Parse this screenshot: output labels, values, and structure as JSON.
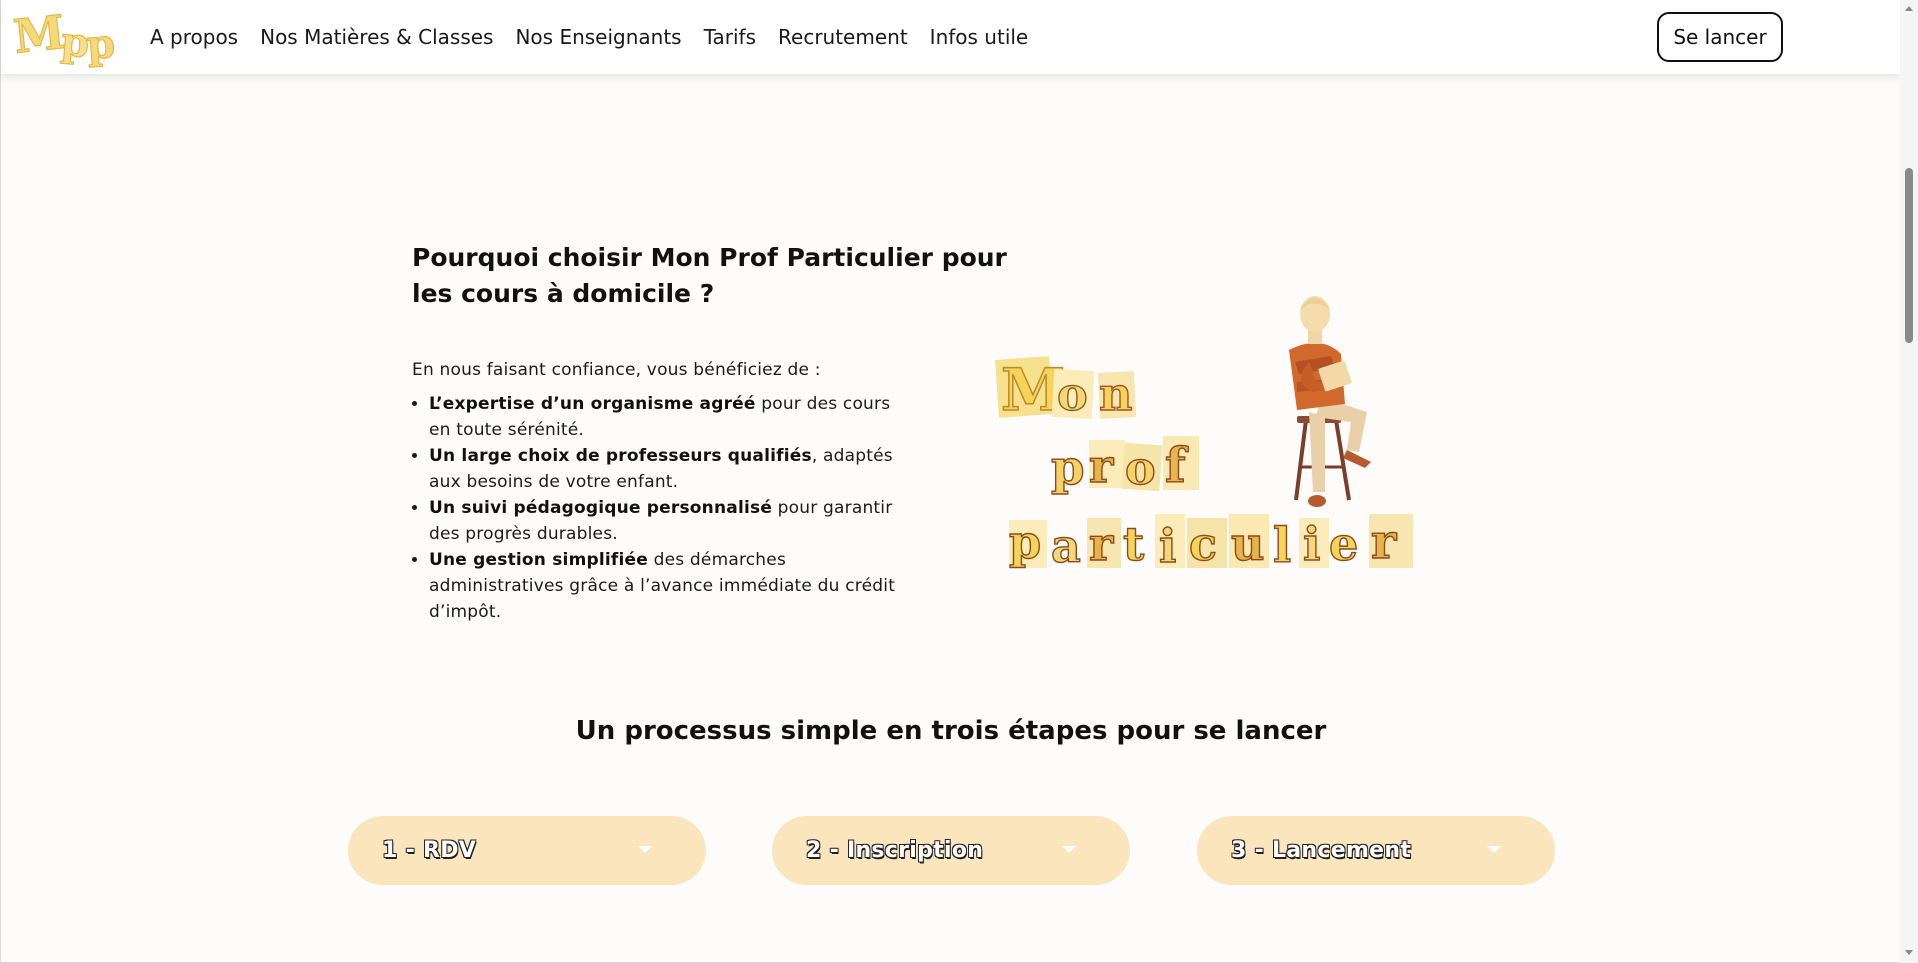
{
  "brand": {
    "logo_text": "Mpp",
    "accent_color": "#f6d978",
    "step_color": "#fbe5bd"
  },
  "nav": {
    "items": [
      {
        "label": "A propos"
      },
      {
        "label": "Nos Matières & Classes"
      },
      {
        "label": "Nos Enseignants"
      },
      {
        "label": "Tarifs"
      },
      {
        "label": "Recrutement"
      },
      {
        "label": "Infos utile"
      }
    ],
    "cta_label": "Se lancer"
  },
  "intro": {
    "title": "Pourquoi choisir Mon Prof Particulier pour les cours à domicile ?",
    "lead": "En nous faisant confiance, vous bénéficiez de :",
    "benefits": [
      {
        "bold": "L’expertise d’un organisme agréé",
        "rest": " pour des cours en toute sérénité."
      },
      {
        "bold": "Un large choix de professeurs qualifiés",
        "rest": ", adaptés aux besoins de votre enfant."
      },
      {
        "bold": "Un suivi pédagogique personnalisé",
        "rest": " pour garantir des progrès durables."
      },
      {
        "bold": "Une gestion simplifiée",
        "rest": " des démarches administratives grâce à l’avance immédiate du crédit d’impôt."
      }
    ]
  },
  "illustration": {
    "words": [
      "Mon",
      "prof",
      "particulier"
    ],
    "icon": "teacher-on-stool-illustration"
  },
  "process": {
    "title": "Un processus simple en trois étapes pour se lancer",
    "steps": [
      {
        "label": "1 - RDV"
      },
      {
        "label": "2 - Inscription"
      },
      {
        "label": "3 - Lancement"
      }
    ]
  }
}
